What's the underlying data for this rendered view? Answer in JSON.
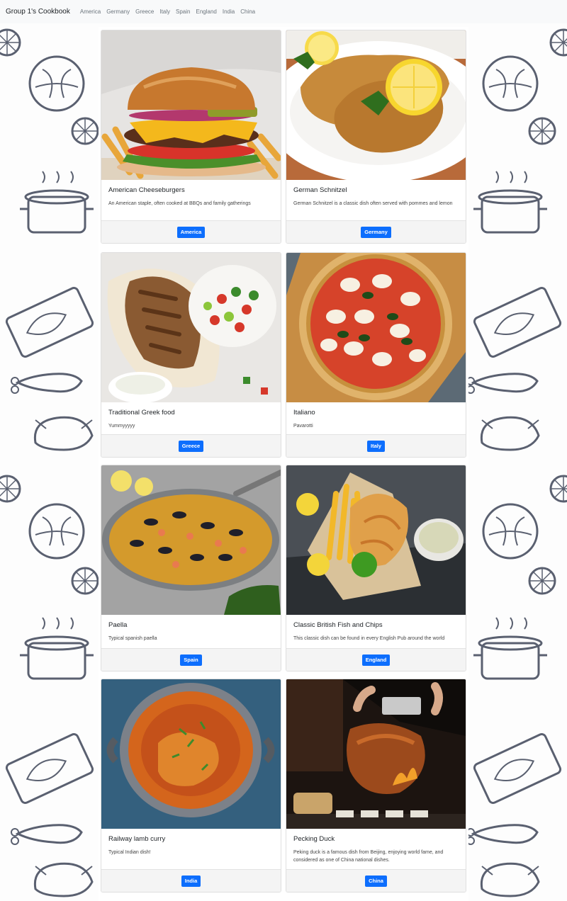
{
  "navbar": {
    "brand": "Group 1's Cookbook",
    "links": [
      "America",
      "Germany",
      "Greece",
      "Italy",
      "Spain",
      "England",
      "India",
      "China"
    ]
  },
  "cards": [
    {
      "title": "American Cheeseburgers",
      "text": "An American staple, often cooked at BBQs and family gatherings",
      "button": "America",
      "image": "burger-photo"
    },
    {
      "title": "German Schnitzel",
      "text": "German Schnitzel is a classic dish often served with pommes and lemon",
      "button": "Germany",
      "image": "schnitzel-photo"
    },
    {
      "title": "Traditional Greek food",
      "text": "Yummyyyyy",
      "button": "Greece",
      "image": "gyro-photo"
    },
    {
      "title": "Italiano",
      "text": "Pavarotti",
      "button": "Italy",
      "image": "pizza-photo"
    },
    {
      "title": "Paella",
      "text": "Typical spanish paella",
      "button": "Spain",
      "image": "paella-photo"
    },
    {
      "title": "Classic British Fish and Chips",
      "text": "This classic dish can be found in every English Pub around the world",
      "button": "England",
      "image": "fish-and-chips-photo"
    },
    {
      "title": "Railway lamb curry",
      "text": "Typical Indian dish!",
      "button": "India",
      "image": "curry-photo"
    },
    {
      "title": "Pecking Duck",
      "text": "Peking duck is a famous dish from Beijing, enjoying world fame, and considered as one of China national dishes.",
      "button": "China",
      "image": "peking-duck-photo"
    }
  ],
  "colors": {
    "button": "#0d6efd",
    "navbar": "#f8f9fa",
    "doodle": "#5a6070"
  }
}
